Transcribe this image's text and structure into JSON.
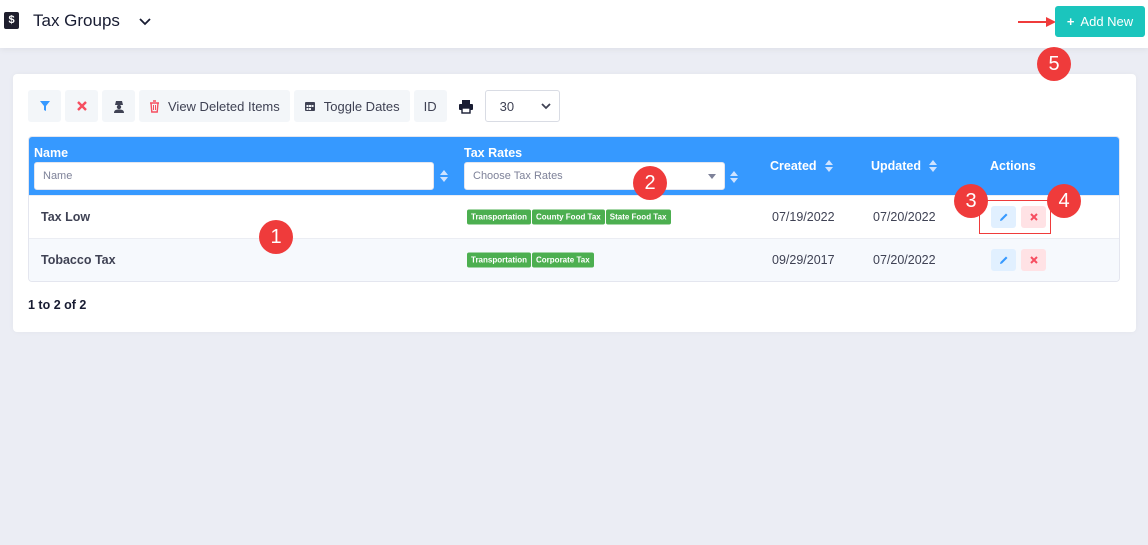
{
  "header": {
    "app_icon_glyph": "$",
    "title": "Tax Groups",
    "add_button_label": "Add New"
  },
  "toolbar": {
    "view_deleted_label": "View Deleted Items",
    "toggle_dates_label": "Toggle Dates",
    "id_label": "ID",
    "page_size_value": "30"
  },
  "table": {
    "columns": {
      "name": "Name",
      "tax_rates": "Tax Rates",
      "created": "Created",
      "updated": "Updated",
      "actions": "Actions"
    },
    "filters": {
      "name_placeholder": "Name",
      "tax_rates_placeholder": "Choose Tax Rates"
    },
    "rows": [
      {
        "name": "Tax Low",
        "tax_rates": [
          "Transportation",
          "County Food Tax",
          "State Food Tax"
        ],
        "created": "07/19/2022",
        "updated": "07/20/2022"
      },
      {
        "name": "Tobacco Tax",
        "tax_rates": [
          "Transportation",
          "Corporate Tax"
        ],
        "created": "09/29/2017",
        "updated": "07/20/2022"
      }
    ]
  },
  "pagination": {
    "summary": "1 to 2 of 2"
  },
  "annotations": [
    "1",
    "2",
    "3",
    "4",
    "5"
  ],
  "colors": {
    "primary": "#3699ff",
    "success": "#1bc5bd",
    "badge": "#4caf50",
    "danger": "#f64e60",
    "annotation": "#ef3b3b"
  }
}
